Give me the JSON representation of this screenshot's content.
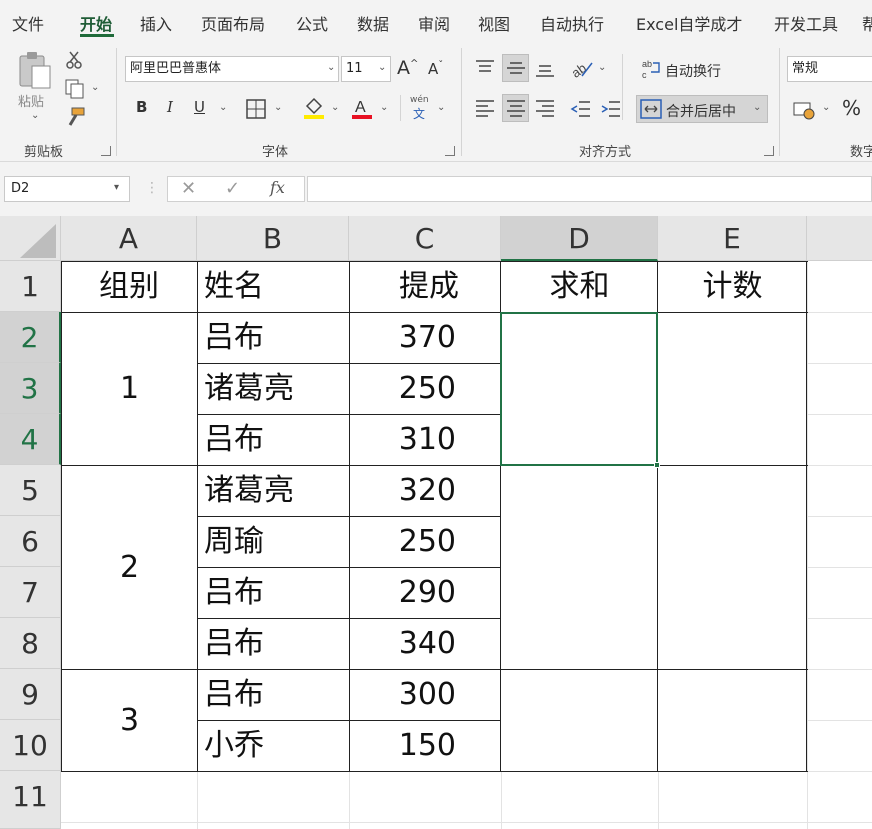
{
  "ribbon": {
    "tabs": [
      "文件",
      "开始",
      "插入",
      "页面布局",
      "公式",
      "数据",
      "审阅",
      "视图",
      "自动执行",
      "Excel自学成才",
      "开发工具",
      "帮"
    ],
    "active_tab": "开始",
    "clipboard": {
      "paste_label": "粘贴",
      "group_label": "剪贴板"
    },
    "font": {
      "name": "阿里巴巴普惠体",
      "size": "11",
      "group_label": "字体",
      "bold": "B",
      "italic": "I",
      "underline": "U",
      "grow": "A",
      "shrink": "A",
      "phonetic_top": "wén",
      "phonetic_bottom": "文"
    },
    "alignment": {
      "wrap_label": "自动换行",
      "merge_label": "合并后居中",
      "group_label": "对齐方式"
    },
    "number": {
      "format": "常规",
      "group_label": "数字",
      "percent": "%"
    },
    "colors": {
      "font_color": "#e81123",
      "fill_color": "#ffeb00",
      "accent": "#217346"
    }
  },
  "formula_bar": {
    "name_box": "D2",
    "formula": "",
    "fx": "fx"
  },
  "columns": [
    "A",
    "B",
    "C",
    "D",
    "E"
  ],
  "rows": [
    "1",
    "2",
    "3",
    "4",
    "5",
    "6",
    "7",
    "8",
    "9",
    "10",
    "11"
  ],
  "selected_cell": "D2",
  "sheet": {
    "headers": {
      "A": "组别",
      "B": "姓名",
      "C": "提成",
      "D": "求和",
      "E": "计数"
    },
    "groups": [
      "1",
      "2",
      "3"
    ],
    "names": [
      "吕布",
      "诸葛亮",
      "吕布",
      "诸葛亮",
      "周瑜",
      "吕布",
      "吕布",
      "吕布",
      "小乔"
    ],
    "commissions": [
      "370",
      "250",
      "310",
      "320",
      "250",
      "290",
      "340",
      "300",
      "150"
    ]
  }
}
